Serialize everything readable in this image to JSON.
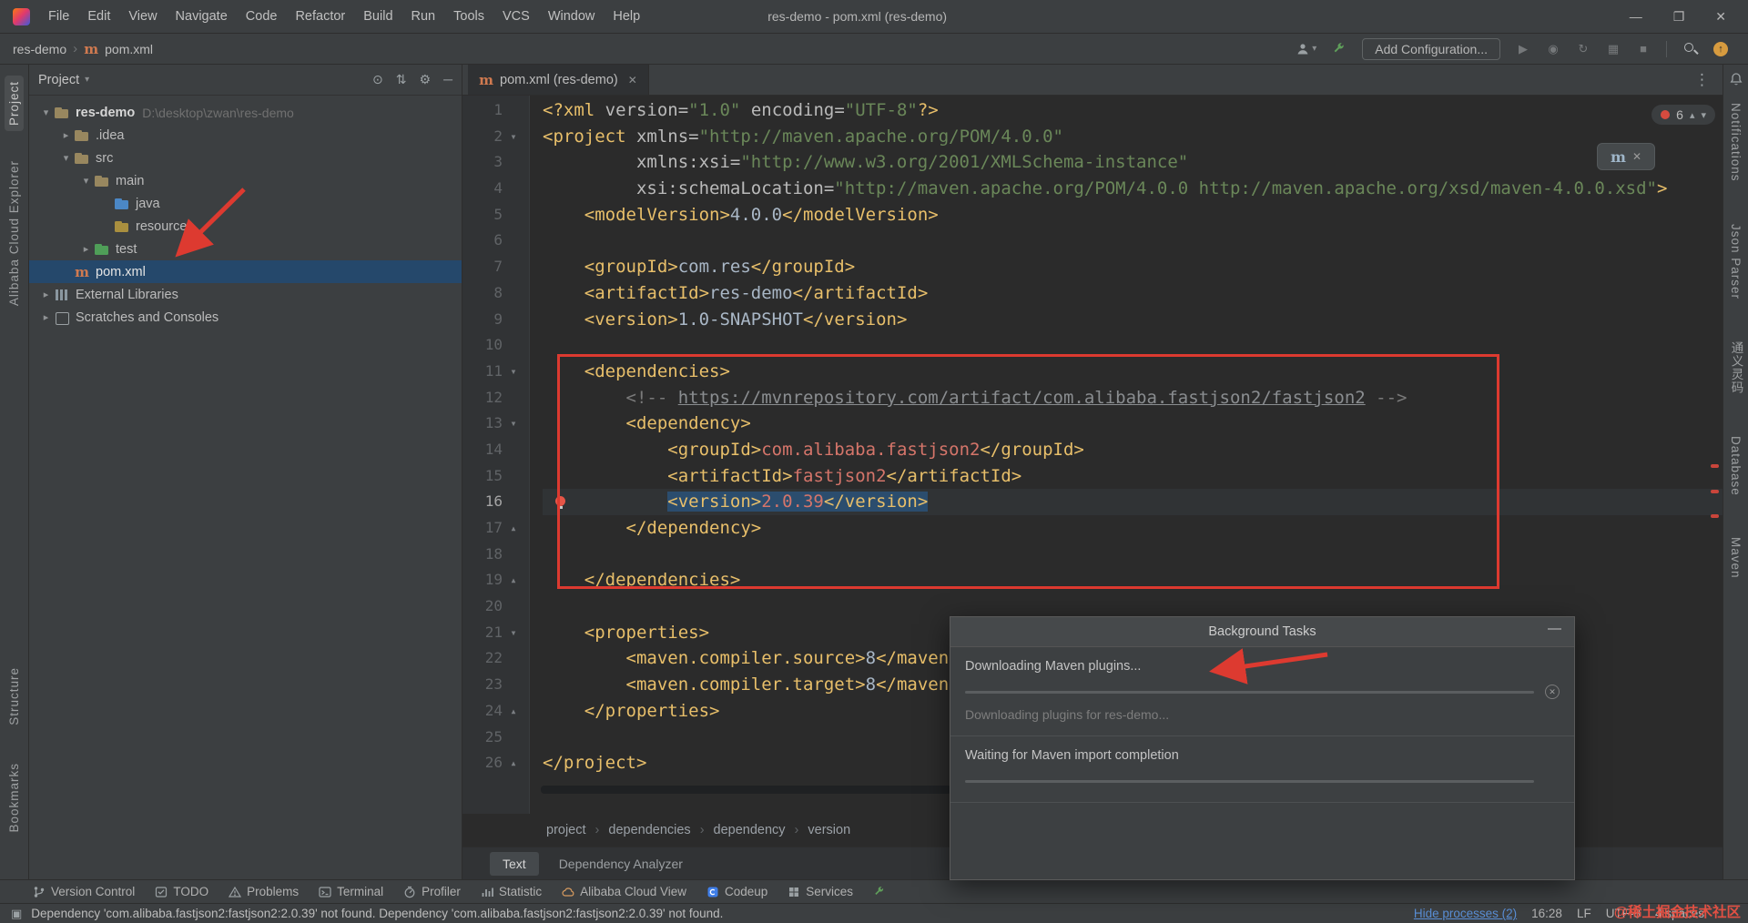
{
  "window": {
    "title": "res-demo - pom.xml (res-demo)",
    "menu": [
      "File",
      "Edit",
      "View",
      "Navigate",
      "Code",
      "Refactor",
      "Build",
      "Run",
      "Tools",
      "VCS",
      "Window",
      "Help"
    ],
    "controls": {
      "minimize": "—",
      "maximize": "❐",
      "close": "✕"
    }
  },
  "toolbar": {
    "breadcrumbs": [
      "res-demo",
      "pom.xml"
    ],
    "add_configuration_label": "Add Configuration..."
  },
  "stripes": {
    "left_top": [
      "Project",
      "Alibaba Cloud Explorer"
    ],
    "left_bottom": [
      "Structure",
      "Bookmarks"
    ],
    "right": [
      "Notifications",
      "Json Parser",
      "通义灵码",
      "Database",
      "Maven"
    ]
  },
  "project_panel": {
    "title": "Project",
    "header_icons": {
      "locate": "⊙",
      "collapse_all": "⇅",
      "settings": "⚙",
      "hide": "─"
    },
    "tree": [
      {
        "label": "res-demo",
        "hint": "D:\\desktop\\zwan\\res-demo",
        "level": 0,
        "icon": "folder",
        "caret": "down",
        "bold": true
      },
      {
        "label": ".idea",
        "level": 1,
        "icon": "folder",
        "caret": "right"
      },
      {
        "label": "src",
        "level": 1,
        "icon": "folder",
        "caret": "down"
      },
      {
        "label": "main",
        "level": 2,
        "icon": "folder",
        "caret": "down"
      },
      {
        "label": "java",
        "level": 3,
        "icon": "folder-java",
        "caret": "none"
      },
      {
        "label": "resources",
        "level": 3,
        "icon": "folder-resources",
        "caret": "none"
      },
      {
        "label": "test",
        "level": 2,
        "icon": "folder-test",
        "caret": "right"
      },
      {
        "label": "pom.xml",
        "level": 1,
        "icon": "maven",
        "caret": "none",
        "selected": true
      },
      {
        "label": "External Libraries",
        "level": 0,
        "icon": "library",
        "caret": "right"
      },
      {
        "label": "Scratches and Consoles",
        "level": 0,
        "icon": "scratch",
        "caret": "right"
      }
    ]
  },
  "editor": {
    "tab_title": "pom.xml (res-demo)",
    "error_widget": {
      "count": "6"
    },
    "breadcrumbs": [
      "project",
      "dependencies",
      "dependency",
      "version"
    ],
    "bottom_tabs": [
      "Text",
      "Dependency Analyzer"
    ],
    "lines": [
      {
        "n": "1",
        "tokens": [
          [
            "tag",
            "<?xml "
          ],
          [
            "attr",
            "version="
          ],
          [
            "str",
            "\"1.0\""
          ],
          [
            "txt",
            " "
          ],
          [
            "attr",
            "encoding="
          ],
          [
            "str",
            "\"UTF-8\""
          ],
          [
            "tag",
            "?>"
          ]
        ]
      },
      {
        "n": "2",
        "fold": "down",
        "tokens": [
          [
            "tag",
            "<project "
          ],
          [
            "attr",
            "xmlns="
          ],
          [
            "str",
            "\"http://maven.apache.org/POM/4.0.0\""
          ]
        ]
      },
      {
        "n": "3",
        "tokens": [
          [
            "txt",
            "         "
          ],
          [
            "attr",
            "xmlns:xsi="
          ],
          [
            "str",
            "\"http://www.w3.org/2001/XMLSchema-instance\""
          ]
        ]
      },
      {
        "n": "4",
        "tokens": [
          [
            "txt",
            "         "
          ],
          [
            "attr",
            "xsi:schemaLocation="
          ],
          [
            "str",
            "\"http://maven.apache.org/POM/4.0.0 http://maven.apache.org/xsd/maven-4.0.0.xsd\""
          ],
          [
            "tag",
            ">"
          ]
        ]
      },
      {
        "n": "5",
        "tokens": [
          [
            "txt",
            "    "
          ],
          [
            "tag",
            "<modelVersion>"
          ],
          [
            "txt",
            "4.0.0"
          ],
          [
            "tag",
            "</modelVersion>"
          ]
        ]
      },
      {
        "n": "6",
        "tokens": []
      },
      {
        "n": "7",
        "tokens": [
          [
            "txt",
            "    "
          ],
          [
            "tag",
            "<groupId>"
          ],
          [
            "txt",
            "com.res"
          ],
          [
            "tag",
            "</groupId>"
          ]
        ]
      },
      {
        "n": "8",
        "tokens": [
          [
            "txt",
            "    "
          ],
          [
            "tag",
            "<artifactId>"
          ],
          [
            "txt",
            "res-demo"
          ],
          [
            "tag",
            "</artifactId>"
          ]
        ]
      },
      {
        "n": "9",
        "tokens": [
          [
            "txt",
            "    "
          ],
          [
            "tag",
            "<version>"
          ],
          [
            "txt",
            "1.0-SNAPSHOT"
          ],
          [
            "tag",
            "</version>"
          ]
        ]
      },
      {
        "n": "10",
        "tokens": []
      },
      {
        "n": "11",
        "fold": "down",
        "tokens": [
          [
            "txt",
            "    "
          ],
          [
            "tag",
            "<dependencies>"
          ]
        ]
      },
      {
        "n": "12",
        "tokens": [
          [
            "txt",
            "        "
          ],
          [
            "com",
            "<!-- "
          ],
          [
            "lnk",
            "https://mvnrepository.com/artifact/com.alibaba.fastjson2/fastjson2"
          ],
          [
            "com",
            " -->"
          ]
        ]
      },
      {
        "n": "13",
        "fold": "down",
        "tokens": [
          [
            "txt",
            "        "
          ],
          [
            "tag",
            "<dependency>"
          ]
        ]
      },
      {
        "n": "14",
        "tokens": [
          [
            "txt",
            "            "
          ],
          [
            "tag",
            "<groupId>"
          ],
          [
            "err",
            "com.alibaba.fastjson2"
          ],
          [
            "tag",
            "</groupId>"
          ]
        ]
      },
      {
        "n": "15",
        "tokens": [
          [
            "txt",
            "            "
          ],
          [
            "tag",
            "<artifactId>"
          ],
          [
            "err",
            "fastjson2"
          ],
          [
            "tag",
            "</artifactId>"
          ]
        ]
      },
      {
        "n": "16",
        "caret": true,
        "bulb": true,
        "tokens": [
          [
            "txt",
            "            "
          ],
          [
            "tag hl",
            "<version>"
          ],
          [
            "err hl",
            "2.0.39"
          ],
          [
            "tag hl",
            "</version>"
          ]
        ]
      },
      {
        "n": "17",
        "fold": "up",
        "tokens": [
          [
            "txt",
            "        "
          ],
          [
            "tag",
            "</dependency>"
          ]
        ]
      },
      {
        "n": "18",
        "tokens": []
      },
      {
        "n": "19",
        "fold": "up",
        "tokens": [
          [
            "txt",
            "    "
          ],
          [
            "tag",
            "</dependencies>"
          ]
        ]
      },
      {
        "n": "20",
        "tokens": []
      },
      {
        "n": "21",
        "fold": "down",
        "tokens": [
          [
            "txt",
            "    "
          ],
          [
            "tag",
            "<properties>"
          ]
        ]
      },
      {
        "n": "22",
        "tokens": [
          [
            "txt",
            "        "
          ],
          [
            "tag",
            "<maven.compiler.source>"
          ],
          [
            "txt",
            "8"
          ],
          [
            "tag",
            "</maven.compiler.source>"
          ]
        ]
      },
      {
        "n": "23",
        "tokens": [
          [
            "txt",
            "        "
          ],
          [
            "tag",
            "<maven.compiler.target>"
          ],
          [
            "txt",
            "8"
          ],
          [
            "tag",
            "</maven.compiler.target>"
          ]
        ]
      },
      {
        "n": "24",
        "fold": "up",
        "tokens": [
          [
            "txt",
            "    "
          ],
          [
            "tag",
            "</properties>"
          ]
        ]
      },
      {
        "n": "25",
        "tokens": []
      },
      {
        "n": "26",
        "fold": "up",
        "tokens": [
          [
            "tag",
            "</project>"
          ]
        ]
      }
    ]
  },
  "background_tasks": {
    "title": "Background Tasks",
    "tasks": [
      {
        "label": "Downloading Maven plugins...",
        "detail": "Downloading plugins for res-demo...",
        "cancellable": true
      },
      {
        "label": "Waiting for Maven import completion",
        "detail": "",
        "cancellable": false
      }
    ]
  },
  "bottom_stripe": {
    "items": [
      {
        "label": "Version Control",
        "icon": "branch-icon"
      },
      {
        "label": "TODO",
        "icon": "todo-icon"
      },
      {
        "label": "Problems",
        "icon": "problems-icon"
      },
      {
        "label": "Terminal",
        "icon": "terminal-icon"
      },
      {
        "label": "Profiler",
        "icon": "profiler-icon"
      },
      {
        "label": "Statistic",
        "icon": "statistic-icon"
      },
      {
        "label": "Alibaba Cloud View",
        "icon": "cloud-icon"
      },
      {
        "label": "Codeup",
        "icon": "codeup-icon"
      },
      {
        "label": "Services",
        "icon": "services-icon"
      },
      {
        "label": "",
        "icon": "wrench-icon"
      }
    ]
  },
  "status_bar": {
    "message": "Dependency 'com.alibaba.fastjson2:fastjson2:2.0.39' not found. Dependency 'com.alibaba.fastjson2:fastjson2:2.0.39' not found.",
    "hide_processes": "Hide processes (2)",
    "caret_position": "16:28",
    "line_ending": "LF",
    "encoding": "UTF-8",
    "indent": "4 spaces",
    "watermark": "@稀土掘金技术社区"
  }
}
